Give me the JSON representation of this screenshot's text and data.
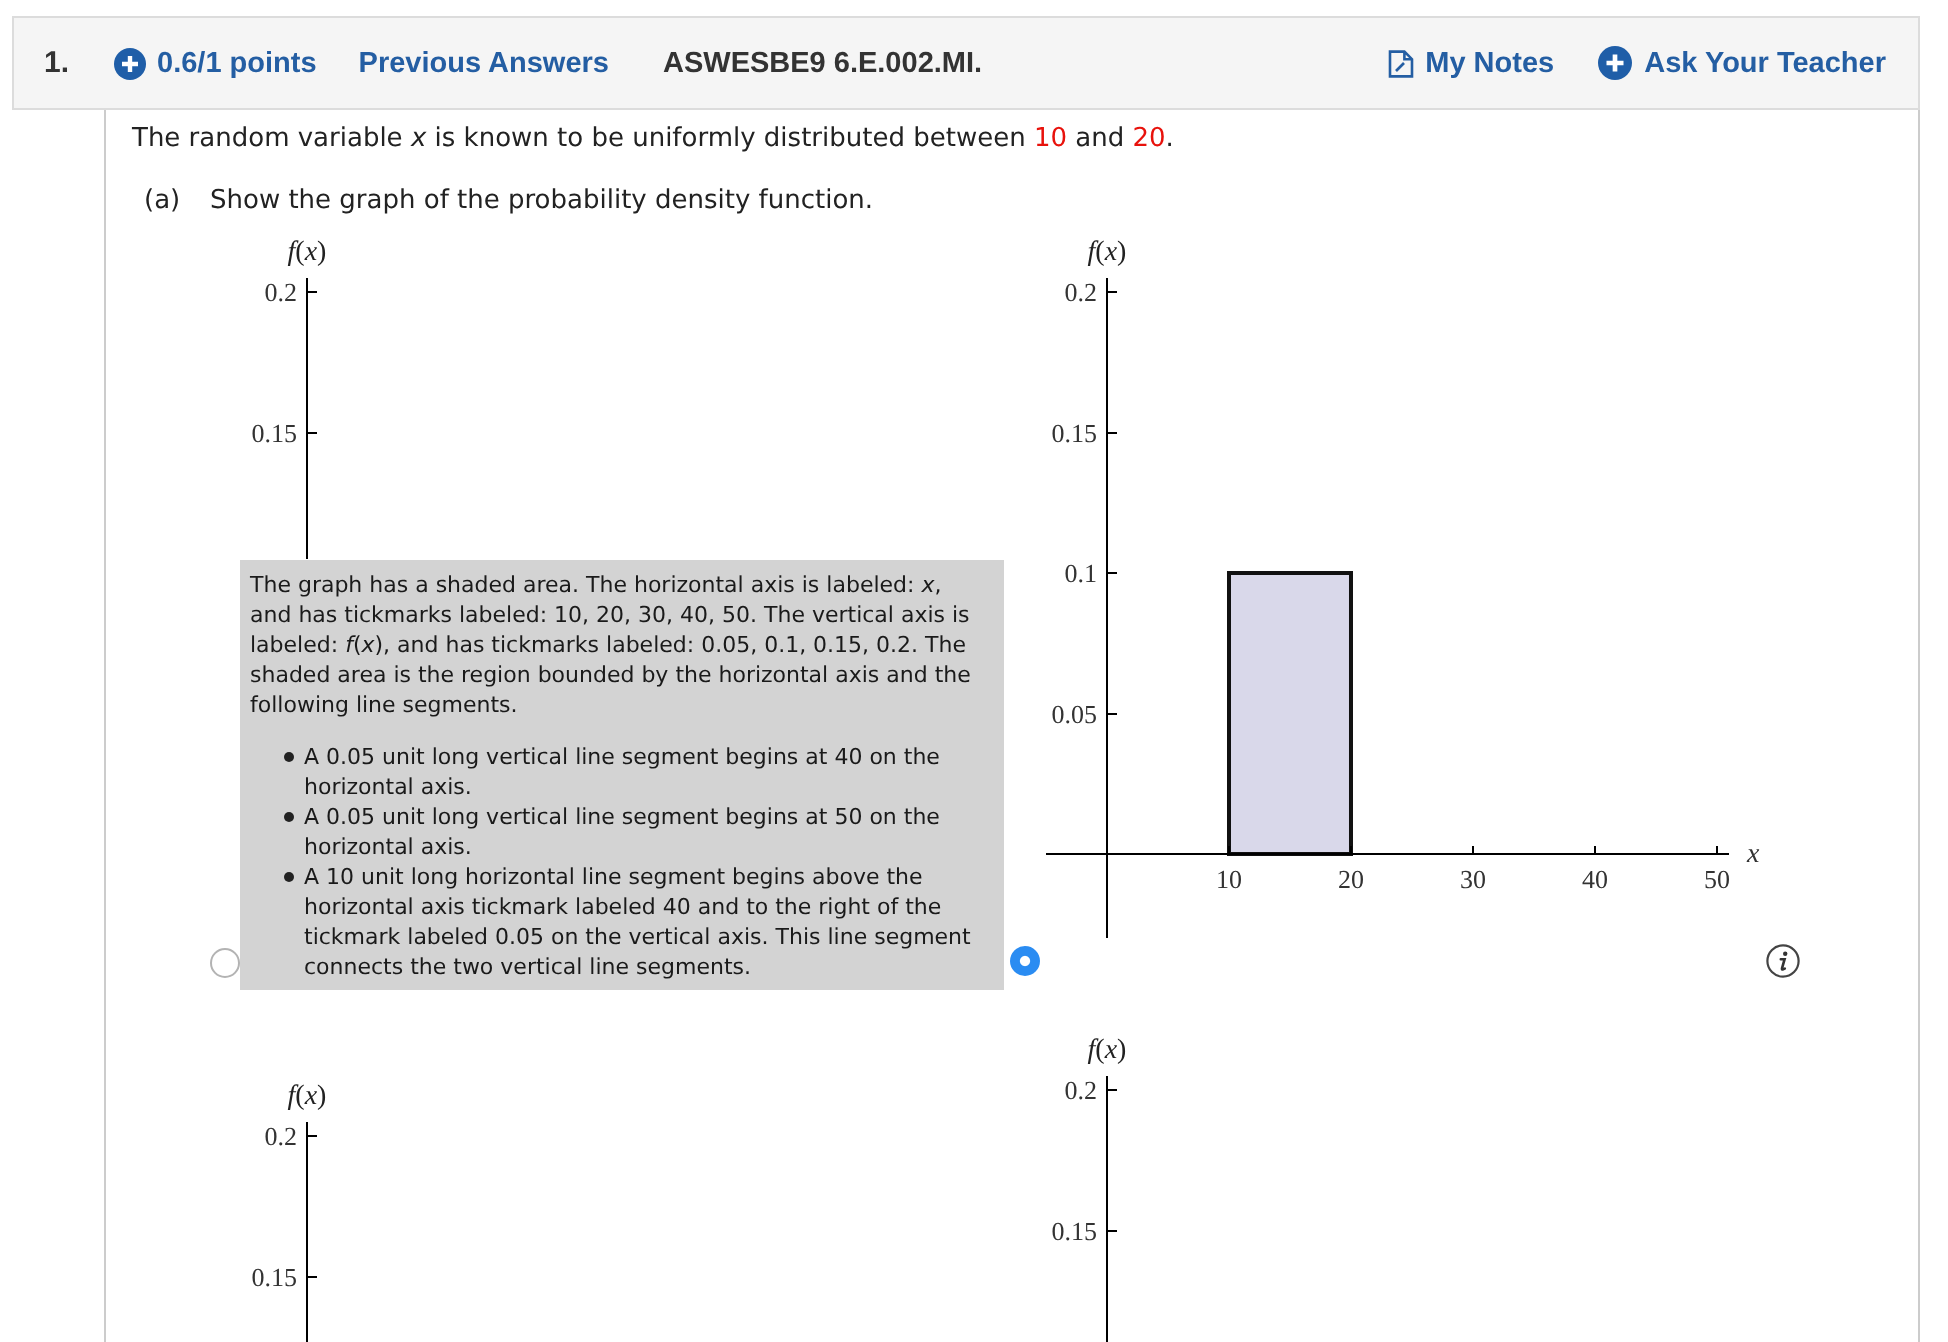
{
  "header": {
    "number": "1.",
    "points": "0.6/1 points",
    "previous_answers": "Previous Answers",
    "code": "ASWESBE9 6.E.002.MI.",
    "my_notes": "My Notes",
    "ask_teacher": "Ask Your Teacher"
  },
  "prompt": [
    {
      "kind": "text",
      "text": "The random variable *x* is known to be uniformly distributed between "
    },
    {
      "kind": "given",
      "text": "10"
    },
    {
      "kind": "text",
      "text": " and "
    },
    {
      "kind": "given",
      "text": "20"
    },
    {
      "kind": "text",
      "text": "."
    }
  ],
  "part": {
    "label": "(a)",
    "instruction": "Show the graph of the probability density function."
  },
  "options": [
    {
      "selected": false,
      "graph": {
        "ylabel": "*f*(*x*)",
        "y_ticks": [
          "0.2",
          "0.15"
        ]
      },
      "description": {
        "text": "The graph has a shaded area. The horizontal axis is labeled: *x*, and has tickmarks labeled: 10, 20, 30, 40, 50. The vertical axis is labeled: *f*(*x*), and has tickmarks labeled: 0.05, 0.1, 0.15, 0.2. The shaded area is the region bounded by the horizontal axis and the following line segments.",
        "items": [
          "A 0.05 unit long vertical line segment begins at 40 on the horizontal axis.",
          "A 0.05 unit long vertical line segment begins at 50 on the horizontal axis.",
          "A 10 unit long horizontal line segment begins above the horizontal axis tickmark labeled 40 and to the right of the tickmark labeled 0.05 on the vertical axis. This line segment connects the two vertical line segments."
        ]
      }
    },
    {
      "selected": true,
      "chart_data": {
        "type": "area",
        "xlabel": "x",
        "ylabel": "*f*(*x*)",
        "x": [
          10,
          20
        ],
        "series": [
          {
            "color": "#d9d8ea",
            "values": [
              0.1,
              0.1
            ]
          }
        ],
        "xlim": [
          -5,
          51
        ],
        "ylim": [
          -0.03,
          0.205
        ],
        "xticks": [
          10,
          20,
          30,
          40,
          50
        ],
        "yticks": [
          0.05,
          0.1,
          0.15,
          0.2
        ]
      }
    },
    {
      "graph": {
        "ylabel": "*f*(*x*)",
        "y_ticks": [
          "0.2",
          "0.15"
        ]
      }
    },
    {
      "graph": {
        "ylabel": "*f*(*x*)",
        "y_ticks": [
          "0.2",
          "0.15"
        ]
      }
    }
  ]
}
